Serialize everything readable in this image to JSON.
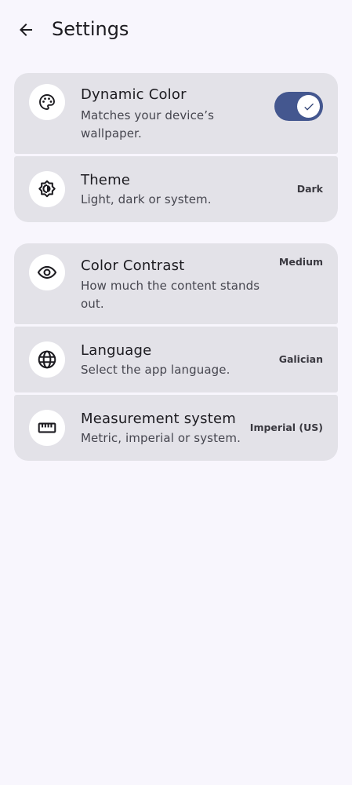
{
  "header": {
    "title": "Settings",
    "back_icon": "arrow-back-icon"
  },
  "colors": {
    "background": "#f8f6fd",
    "card": "#e3e2e8",
    "toggle_on": "#44578f"
  },
  "groups": [
    {
      "items": [
        {
          "id": "dynamic-color",
          "icon": "palette-icon",
          "title": "Dynamic Color",
          "subtitle": "Matches your device’s wallpaper.",
          "control": "toggle",
          "toggle_on": true
        },
        {
          "id": "theme",
          "icon": "brightness-auto-icon",
          "title": "Theme",
          "subtitle": "Light, dark or system.",
          "value": "Dark"
        }
      ]
    },
    {
      "items": [
        {
          "id": "color-contrast",
          "icon": "eye-icon",
          "title": "Color Contrast",
          "subtitle": "How much the content stands out.",
          "value": "Medium"
        },
        {
          "id": "language",
          "icon": "globe-icon",
          "title": "Language",
          "subtitle": "Select the app language.",
          "value": "Galician"
        },
        {
          "id": "measurement-system",
          "icon": "ruler-icon",
          "title": "Measurement system",
          "subtitle": "Metric, imperial or system.",
          "value": "Imperial (US)"
        }
      ]
    }
  ]
}
